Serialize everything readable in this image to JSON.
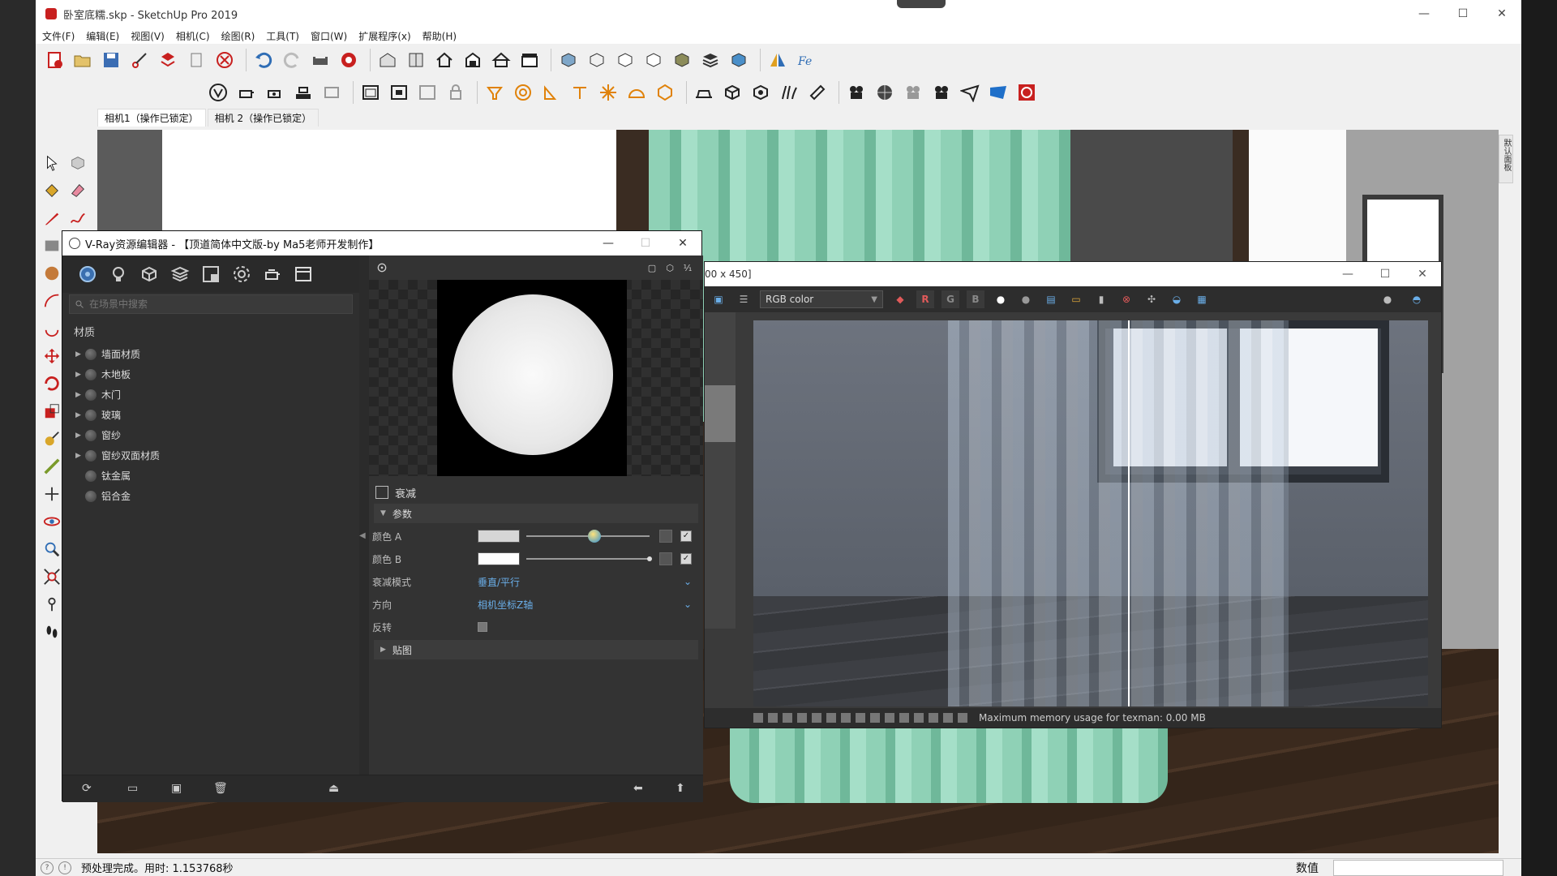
{
  "window": {
    "title": "卧室底糯.skp - SketchUp Pro 2019",
    "minimize": "—",
    "maximize": "☐",
    "close": "✕"
  },
  "menu": [
    "文件(F)",
    "编辑(E)",
    "视图(V)",
    "相机(C)",
    "绘图(R)",
    "工具(T)",
    "窗口(W)",
    "扩展程序(x)",
    "帮助(H)"
  ],
  "scene_tabs": [
    "相机1（操作已锁定）",
    "相机 2（操作已锁定）"
  ],
  "right_dock_label": "默认面板",
  "vray_editor": {
    "title": "V-Ray资源编辑器 - 【顶道简体中文版-by Ma5老师开发制作】",
    "minimize": "—",
    "maximize": "☐",
    "close": "✕",
    "search_placeholder": "在场景中搜索",
    "list_header": "材质",
    "materials": [
      {
        "name": "墙面材质",
        "expandable": true
      },
      {
        "name": "木地板",
        "expandable": true
      },
      {
        "name": "木门",
        "expandable": true
      },
      {
        "name": "玻璃",
        "expandable": true
      },
      {
        "name": "窗纱",
        "expandable": true
      },
      {
        "name": "窗纱双面材质",
        "expandable": true
      },
      {
        "name": "钛金属",
        "expandable": false
      },
      {
        "name": "铝合金",
        "expandable": false
      }
    ],
    "preview_icons": [
      "▢",
      "⬡",
      "⅟₁"
    ],
    "falloff": {
      "header": "衰减",
      "section_params": "参数",
      "color_a_label": "颜色 A",
      "color_a": "#d6d6d6",
      "color_a_level": 0.55,
      "color_b_label": "颜色 B",
      "color_b": "#ffffff",
      "color_b_level": 1.0,
      "mode_label": "衰减模式",
      "mode_value": "垂直/平行",
      "direction_label": "方向",
      "direction_value": "相机坐标Z轴",
      "invert_label": "反转",
      "section_maps": "贴图"
    }
  },
  "vfb": {
    "title": "00 x 450]",
    "minimize": "—",
    "maximize": "☐",
    "close": "✕",
    "channel": "RGB color",
    "channel_buttons": [
      "R",
      "G",
      "B"
    ],
    "status_text": "Maximum memory usage for texman: 0.00 MB"
  },
  "status": {
    "message": "预处理完成。用时: 1.153768秒",
    "measure_label": "数值",
    "measure_value": ""
  },
  "colors": {
    "accent_blue": "#2a8ed6",
    "dropdown_text": "#6aaee8",
    "curtain_green": "#8fd1b6"
  }
}
